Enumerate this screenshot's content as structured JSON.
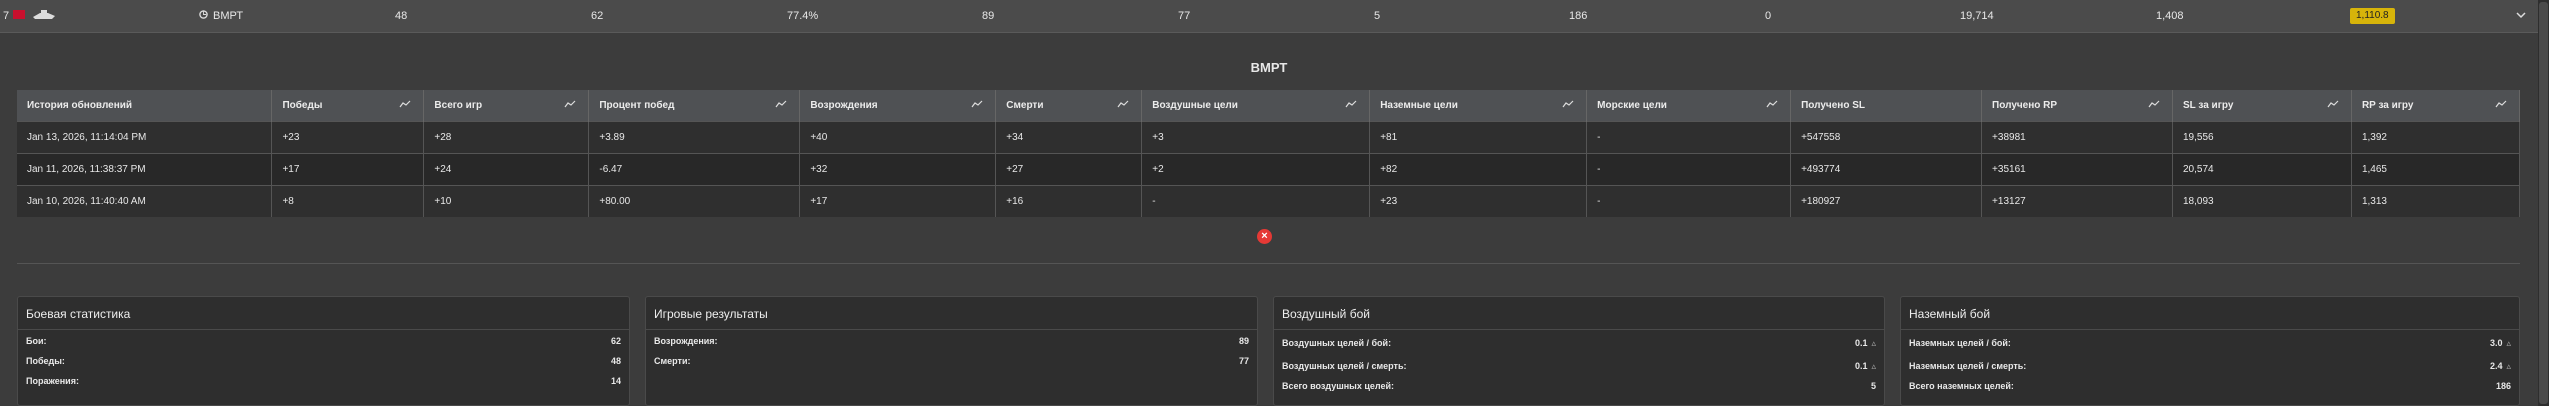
{
  "topbar": {
    "rank": "7",
    "vehicle_name": "ВМРТ",
    "stats": [
      "48",
      "62",
      "77.4%",
      "89",
      "77",
      "5",
      "186",
      "0",
      "19,714",
      "1,408"
    ],
    "badge": "1,110.8"
  },
  "colors": {
    "badge": "#d7b40a",
    "close": "#e53935",
    "flag": "#c8102e"
  },
  "section_title": "ВМРТ",
  "history": {
    "headers": [
      "История обновлений",
      "Победы",
      "Всего игр",
      "Процент побед",
      "Возрождения",
      "Смерти",
      "Воздушные цели",
      "Наземные цели",
      "Морские цели",
      "Получено SL",
      "Получено RP",
      "SL за игру",
      "RP за игру"
    ],
    "rows": [
      [
        "Jan 13, 2026, 11:14:04 PM",
        "+23",
        "+28",
        "+3.89",
        "+40",
        "+34",
        "+3",
        "+81",
        "-",
        "+547558",
        "+38981",
        "19,556",
        "1,392"
      ],
      [
        "Jan 11, 2026, 11:38:37 PM",
        "+17",
        "+24",
        "-6.47",
        "+32",
        "+27",
        "+2",
        "+82",
        "-",
        "+493774",
        "+35161",
        "20,574",
        "1,465"
      ],
      [
        "Jan 10, 2026, 11:40:40 AM",
        "+8",
        "+10",
        "+80.00",
        "+17",
        "+16",
        "-",
        "+23",
        "-",
        "+180927",
        "+13127",
        "18,093",
        "1,313"
      ]
    ]
  },
  "panels": {
    "combat": {
      "title": "Боевая статистика",
      "rows": [
        {
          "label": "Бои:",
          "value": "62"
        },
        {
          "label": "Победы:",
          "value": "48"
        },
        {
          "label": "Поражения:",
          "value": "14"
        }
      ]
    },
    "results": {
      "title": "Игровые результаты",
      "rows": [
        {
          "label": "Возрождения:",
          "value": "89"
        },
        {
          "label": "Смерти:",
          "value": "77"
        }
      ]
    },
    "air": {
      "title": "Воздушный бой",
      "rows": [
        {
          "label": "Воздушных целей / бой:",
          "value": "0.1"
        },
        {
          "label": "Воздушных целей / смерть:",
          "value": "0.1"
        },
        {
          "label": "Всего воздушных целей:",
          "value": "5"
        }
      ]
    },
    "ground": {
      "title": "Наземный бой",
      "rows": [
        {
          "label": "Наземных целей / бой:",
          "value": "3.0"
        },
        {
          "label": "Наземных целей / смерть:",
          "value": "2.4"
        },
        {
          "label": "Всего наземных целей:",
          "value": "186"
        }
      ]
    }
  }
}
